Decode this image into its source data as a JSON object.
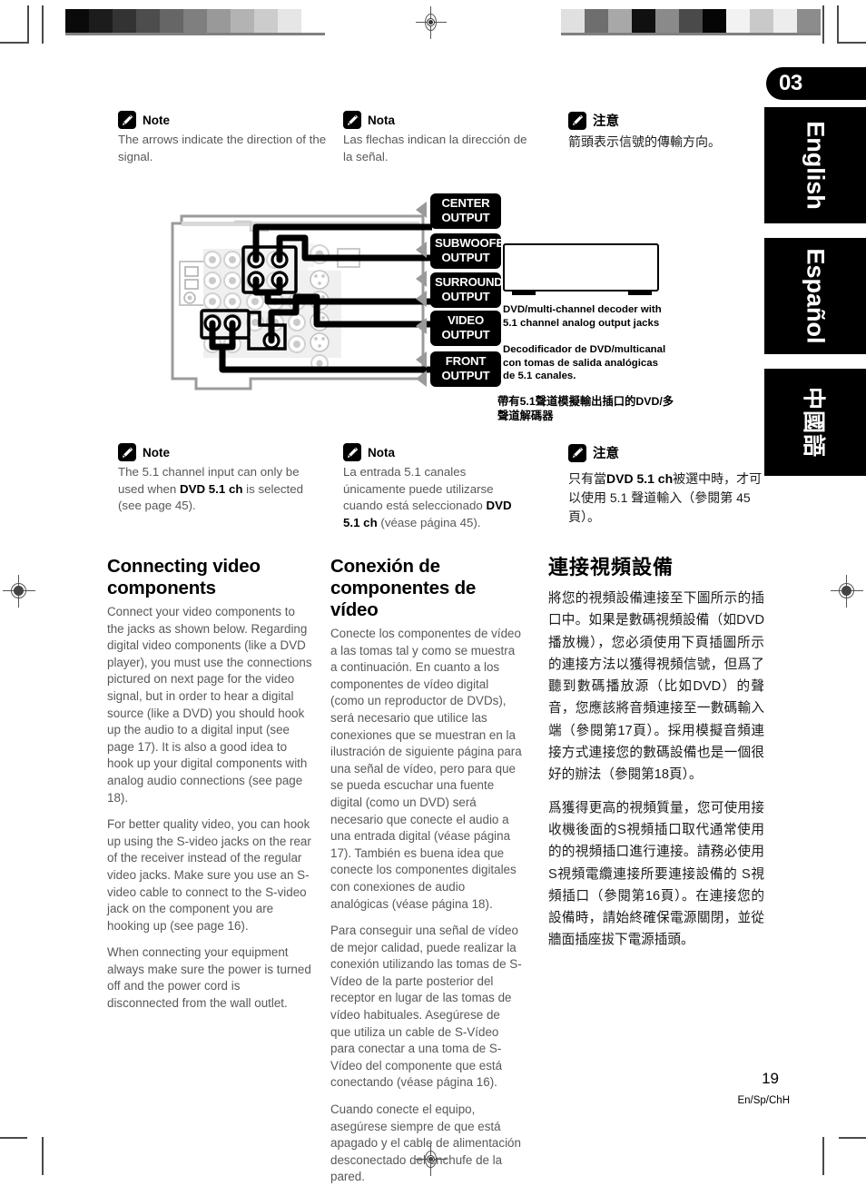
{
  "chapter": {
    "number": "03"
  },
  "language_tabs": [
    {
      "name": "english",
      "label": "English"
    },
    {
      "name": "espanol",
      "label": "Español"
    },
    {
      "name": "chinese",
      "label": "中國語"
    }
  ],
  "notes_top": [
    {
      "lang": "en",
      "icon": "pencil-note-icon",
      "title": "Note",
      "body": "The arrows indicate the direction of the signal."
    },
    {
      "lang": "es",
      "icon": "pencil-note-icon",
      "title": "Nota",
      "body": "Las flechas indican la dirección de la señal."
    },
    {
      "lang": "zh",
      "icon": "pencil-note-icon",
      "title": "注意",
      "body": "箭頭表示信號的傳輸方向。"
    }
  ],
  "diagram": {
    "output_labels": [
      {
        "line1": "CENTER",
        "line2": "OUTPUT"
      },
      {
        "line1": "SUBWOOFER",
        "line2": "OUTPUT"
      },
      {
        "line1": "SURROUND",
        "line2": "OUTPUT"
      },
      {
        "line1": "VIDEO",
        "line2": "OUTPUT"
      },
      {
        "line1": "FRONT",
        "line2": "OUTPUT"
      }
    ],
    "captions": {
      "en": "DVD/multi-channel decoder with 5.1 channel analog output jacks",
      "es": "Decodificador de DVD/multicanal con tomas de salida analógicas de 5.1 canales.",
      "zh": "帶有5.1聲道模擬輸出插口的DVD/多聲道解碼器"
    }
  },
  "notes_bottom": [
    {
      "lang": "en",
      "icon": "pencil-note-icon",
      "title": "Note",
      "body_pre": "The 5.1 channel input can only be used when ",
      "body_bold": "DVD 5.1 ch",
      "body_post": " is selected (see page 45)."
    },
    {
      "lang": "es",
      "icon": "pencil-note-icon",
      "title": "Nota",
      "body_pre": "La entrada 5.1 canales únicamente puede utilizarse cuando está seleccionado ",
      "body_bold": "DVD 5.1 ch",
      "body_post": " (véase página 45)."
    },
    {
      "lang": "zh",
      "icon": "pencil-note-icon",
      "title": "注意",
      "body_pre": "只有當",
      "body_bold": "DVD 5.1 ch",
      "body_post": "被選中時，才可以使用 5.1 聲道輸入（參閱第 45 頁）。"
    }
  ],
  "columns": {
    "english": {
      "heading": "Connecting video components",
      "paragraphs": [
        "Connect your video components to the jacks as shown below. Regarding digital video components (like a DVD player), you must use the connections pictured on next page for the video signal, but in order to hear a digital source (like a DVD) you should hook up the audio to a digital input (see page 17). It is also a good idea to hook up your digital components with analog audio connections (see page 18).",
        "For better quality video, you can hook up using the S-video jacks on the rear of the receiver instead of the regular video jacks. Make sure you use an S-video cable to connect to the S-video jack on the component you are hooking up (see page 16).",
        "When connecting your equipment always make sure the power is turned off and the power cord is disconnected from the wall outlet."
      ]
    },
    "espanol": {
      "heading": "Conexión de componentes de vídeo",
      "paragraphs": [
        "Conecte los componentes de vídeo a las tomas tal y como se muestra a continuación. En cuanto a los componentes de vídeo digital (como un reproductor de DVDs), será necesario que utilice las conexiones que se muestran en la ilustración de siguiente página para una señal de vídeo, pero para que se pueda escuchar una fuente digital (como un DVD) será necesario que conecte el audio a una entrada digital (véase página 17). También es buena idea que conecte los componentes digitales con conexiones de audio analógicas (véase página 18).",
        "Para conseguir una señal de vídeo de mejor calidad, puede realizar la conexión utilizando las tomas de S-Vídeo de la parte posterior del receptor en lugar de las tomas de vídeo habituales. Asegúrese de que utiliza un cable de S-Vídeo para conectar a una toma de S-Vídeo del componente que está conectando (véase página 16).",
        "Cuando conecte el equipo, asegúrese siempre de que está apagado y el cable de alimentación desconectado del enchufe de la pared."
      ]
    },
    "chinese": {
      "heading": "連接視頻設備",
      "paragraphs": [
        "將您的視頻設備連接至下圖所示的插口中。如果是數碼視頻設備（如DVD 播放機），您必須使用下頁插圖所示的連接方法以獲得視頻信號，但爲了聽到數碼播放源（比如DVD）的聲音，您應該將音頻連接至一數碼輸入端（參閱第17頁）。採用模擬音頻連接方式連接您的數碼設備也是一個很好的辦法（參閱第18頁）。",
        "爲獲得更高的視頻質量，您可使用接收機後面的S視頻插口取代通常使用的的視頻插口進行連接。請務必使用 S視頻電纜連接所要連接設備的 S視頻插口（參閱第16頁）。在連接您的設備時，請始終確保電源關閉，並從牆面插座拔下電源插頭。"
      ]
    }
  },
  "footer": {
    "page_number": "19",
    "language_code": "En/Sp/ChH"
  },
  "calibration": {
    "left_swatches": [
      "#0a0a0a",
      "#1c1c1c",
      "#333333",
      "#4d4d4d",
      "#666666",
      "#7f7f7f",
      "#999999",
      "#b3b3b3",
      "#cccccc",
      "#e6e6e6",
      "#ffffff"
    ],
    "right_swatches": [
      "#e0e0e0",
      "#6e6e6e",
      "#a8a8a8",
      "#101010",
      "#8a8a8a",
      "#4a4a4a",
      "#050505",
      "#f2f2f2",
      "#c9c9c9",
      "#ededed",
      "#8c8c8c"
    ]
  }
}
